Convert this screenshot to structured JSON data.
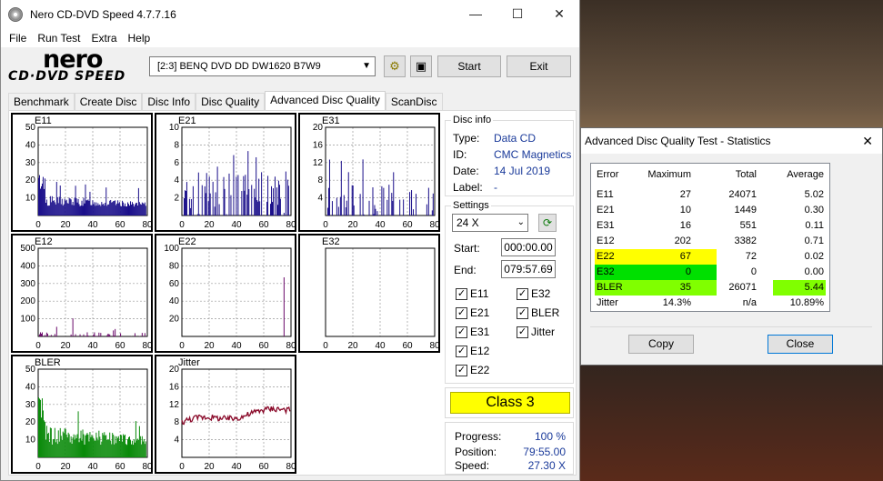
{
  "window": {
    "title": "Nero CD-DVD Speed 4.7.7.16",
    "minimize": "—",
    "maximize": "☐",
    "close": "✕"
  },
  "menu": [
    "File",
    "Run Test",
    "Extra",
    "Help"
  ],
  "logo": {
    "top": "nero",
    "bottom": "CD·DVD SPEED"
  },
  "toolbar": {
    "drive": "[2:3]   BENQ DVD DD DW1620 B7W9",
    "start_label": "Start",
    "exit_label": "Exit"
  },
  "tabs": [
    "Benchmark",
    "Create Disc",
    "Disc Info",
    "Disc Quality",
    "Advanced Disc Quality",
    "ScanDisc"
  ],
  "active_tab": "Advanced Disc Quality",
  "disc_info": {
    "title": "Disc info",
    "type_label": "Type:",
    "type": "Data CD",
    "id_label": "ID:",
    "id": "CMC Magnetics",
    "date_label": "Date:",
    "date": "14 Jul 2019",
    "label_label": "Label:",
    "label": "-"
  },
  "settings": {
    "title": "Settings",
    "speed": "24 X",
    "start_label": "Start:",
    "start": "000:00.00",
    "end_label": "End:",
    "end": "079:57.69",
    "checks": [
      {
        "label": "E11",
        "checked": true
      },
      {
        "label": "E32",
        "checked": true
      },
      {
        "label": "E21",
        "checked": true
      },
      {
        "label": "BLER",
        "checked": true
      },
      {
        "label": "E31",
        "checked": true
      },
      {
        "label": "Jitter",
        "checked": true
      },
      {
        "label": "E12",
        "checked": true
      },
      {
        "label": "E22",
        "checked": true
      }
    ]
  },
  "class_label": "Class 3",
  "progress": {
    "progress_label": "Progress:",
    "progress": "100 %",
    "position_label": "Position:",
    "position": "79:55.00",
    "speed_label": "Speed:",
    "speed": "27.30 X"
  },
  "stats_dialog": {
    "title": "Advanced Disc Quality Test - Statistics",
    "close": "✕",
    "headers": [
      "Error",
      "Maximum",
      "Total",
      "Average"
    ],
    "rows": [
      {
        "name": "E11",
        "max": "27",
        "total": "24071",
        "avg": "5.02"
      },
      {
        "name": "E21",
        "max": "10",
        "total": "1449",
        "avg": "0.30"
      },
      {
        "name": "E31",
        "max": "16",
        "total": "551",
        "avg": "0.11"
      },
      {
        "name": "E12",
        "max": "202",
        "total": "3382",
        "avg": "0.71"
      },
      {
        "name": "E22",
        "max": "67",
        "total": "72",
        "avg": "0.02"
      },
      {
        "name": "E32",
        "max": "0",
        "total": "0",
        "avg": "0.00"
      },
      {
        "name": "BLER",
        "max": "35",
        "total": "26071",
        "avg": "5.44"
      },
      {
        "name": "Jitter",
        "max": "14.3%",
        "total": "n/a",
        "avg": "10.89%"
      }
    ],
    "copy_label": "Copy",
    "close_label": "Close"
  },
  "chart_data": [
    {
      "type": "bar",
      "title": "E11",
      "color": "#1a0f8a",
      "yticks": [
        10,
        20,
        30,
        40,
        50
      ],
      "ylim": [
        0,
        50
      ],
      "xticks": [
        0,
        20,
        40,
        60,
        80
      ],
      "xlim": [
        0,
        80
      ],
      "peak": 27
    },
    {
      "type": "bar",
      "title": "E21",
      "color": "#1a0f8a",
      "yticks": [
        2,
        4,
        6,
        8,
        10
      ],
      "ylim": [
        0,
        10
      ],
      "xticks": [
        0,
        20,
        40,
        60,
        80
      ],
      "xlim": [
        0,
        80
      ],
      "peak": 10
    },
    {
      "type": "bar",
      "title": "E31",
      "color": "#1a0f8a",
      "yticks": [
        4,
        8,
        12,
        16,
        20
      ],
      "ylim": [
        0,
        20
      ],
      "xticks": [
        0,
        20,
        40,
        60,
        80
      ],
      "xlim": [
        0,
        80
      ],
      "peak": 16
    },
    {
      "type": "bar",
      "title": "E12",
      "color": "#6a0a6a",
      "yticks": [
        100,
        200,
        300,
        400,
        500
      ],
      "ylim": [
        0,
        500
      ],
      "xticks": [
        0,
        20,
        40,
        60,
        80
      ],
      "xlim": [
        0,
        80
      ],
      "peak": 202
    },
    {
      "type": "bar",
      "title": "E22",
      "color": "#6a0a6a",
      "yticks": [
        20,
        40,
        60,
        80,
        100
      ],
      "ylim": [
        0,
        100
      ],
      "xticks": [
        0,
        20,
        40,
        60,
        80
      ],
      "xlim": [
        0,
        80
      ],
      "peak": 67
    },
    {
      "type": "bar",
      "title": "E32",
      "color": "#6a0a6a",
      "yticks": [],
      "ylim": [
        0,
        5
      ],
      "xticks": [
        0,
        20,
        40,
        60,
        80
      ],
      "xlim": [
        0,
        80
      ],
      "peak": 0
    },
    {
      "type": "bar",
      "title": "BLER",
      "color": "#0a8a0a",
      "yticks": [
        10,
        20,
        30,
        40,
        50
      ],
      "ylim": [
        0,
        50
      ],
      "xticks": [
        0,
        20,
        40,
        60,
        80
      ],
      "xlim": [
        0,
        80
      ],
      "peak": 35
    },
    {
      "type": "line",
      "title": "Jitter",
      "color": "#8a0a2a",
      "yticks": [
        4,
        8,
        12,
        16,
        20
      ],
      "ylim": [
        0,
        20
      ],
      "xticks": [
        0,
        20,
        40,
        60,
        80
      ],
      "xlim": [
        0,
        80
      ],
      "series_start": 8,
      "series_end": 11,
      "peak": 14.3
    }
  ]
}
